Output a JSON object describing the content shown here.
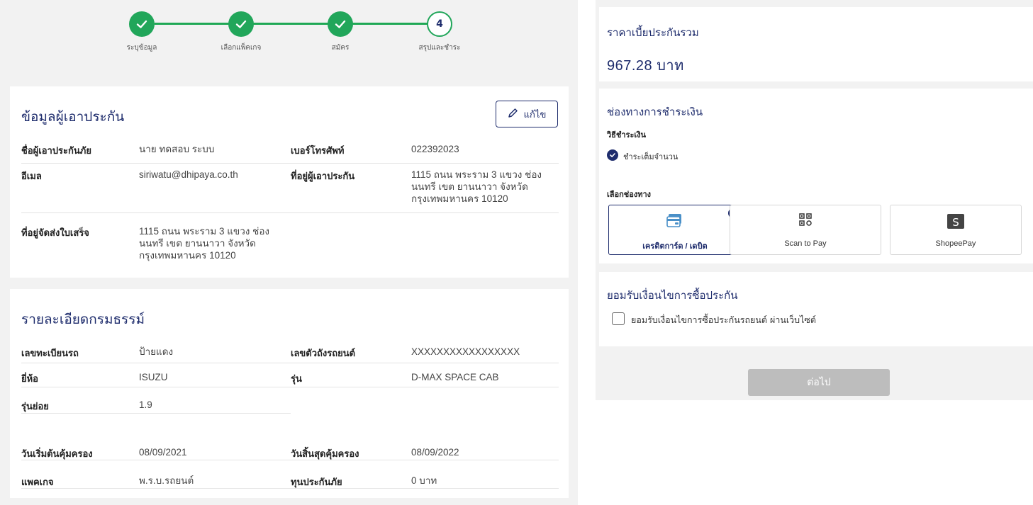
{
  "stepper": {
    "steps": [
      {
        "label": "ระบุข้อมูล",
        "status": "done"
      },
      {
        "label": "เลือกแพ็คเกจ",
        "status": "done"
      },
      {
        "label": "สมัคร",
        "status": "done"
      },
      {
        "label": "สรุปและชำระ",
        "status": "current",
        "number": "4"
      }
    ]
  },
  "insured": {
    "title": "ข้อมูลผู้เอาประกัน",
    "edit_label": "แก้ไข",
    "rows": [
      {
        "l1": "ชื่อผู้เอาประกันภัย",
        "v1": "นาย ทดสอบ ระบบ",
        "l2": "เบอร์โทรศัพท์",
        "v2": "022392023"
      },
      {
        "l1": "อีเมล",
        "v1": "siriwatu@dhipaya.co.th",
        "l2": "ที่อยู่ผู้เอาประกัน",
        "v2": "1115 ถนน พระราม 3 แขวง ช่อง นนทรี เขต ยานนาวา จังหวัด กรุงเทพมหานคร 10120"
      },
      {
        "l1": "ที่อยู่จัดส่งใบเสร็จ",
        "v1": "1115 ถนน พระราม 3 แขวง ช่อง นนทรี เขต ยานนาวา จังหวัด กรุงเทพมหานคร 10120"
      }
    ]
  },
  "policy": {
    "title": "รายละเอียดกรมธรรม์",
    "rows": [
      {
        "l1": "เลขทะเบียนรถ",
        "v1": "ป้ายแดง",
        "l2": "เลขตัวถังรถยนต์",
        "v2": "XXXXXXXXXXXXXXXXX"
      },
      {
        "l1": "ยี่ห้อ",
        "v1": "ISUZU",
        "l2": "รุ่น",
        "v2": "D-MAX SPACE CAB"
      },
      {
        "l1": "รุ่นย่อย",
        "v1": "1.9"
      },
      {
        "l1": "วันเริ่มต้นคุ้มครอง",
        "v1": "08/09/2021",
        "l2": "วันสิ้นสุดคุ้มครอง",
        "v2": "08/09/2022"
      },
      {
        "l1": "แพคเกจ",
        "v1": "พ.ร.บ.รถยนต์",
        "l2": "ทุนประกันภัย",
        "v2": "0 บาท"
      }
    ]
  },
  "summary": {
    "title": "ราคาเบี้ยประกันรวม",
    "price": "967.28 บาท"
  },
  "payment": {
    "title": "ช่องทางการชำระเงิน",
    "method_label": "วิธีชำระเงิน",
    "method_option": "ชำระเต็มจำนวน",
    "channel_label": "เลือกช่องทาง",
    "channels": [
      {
        "label": "เครดิตการ์ด / เดบิต",
        "icon": "credit-card-icon",
        "selected": true
      },
      {
        "label": "Scan to Pay",
        "icon": "qr-code-icon",
        "selected": false
      },
      {
        "label": "ShopeePay",
        "icon": "shopeepay-icon",
        "selected": false
      }
    ]
  },
  "terms": {
    "title": "ยอมรับเงื่อนไขการซื้อประกัน",
    "checkbox_label": "ยอมรับเงื่อนไขการซื้อประกันรถยนต์ ผ่านเว็บไซต์"
  },
  "next_label": "ต่อไป",
  "colors": {
    "primary": "#1f2d6d",
    "success": "#21a65a",
    "disabled": "#bdbdbd"
  }
}
